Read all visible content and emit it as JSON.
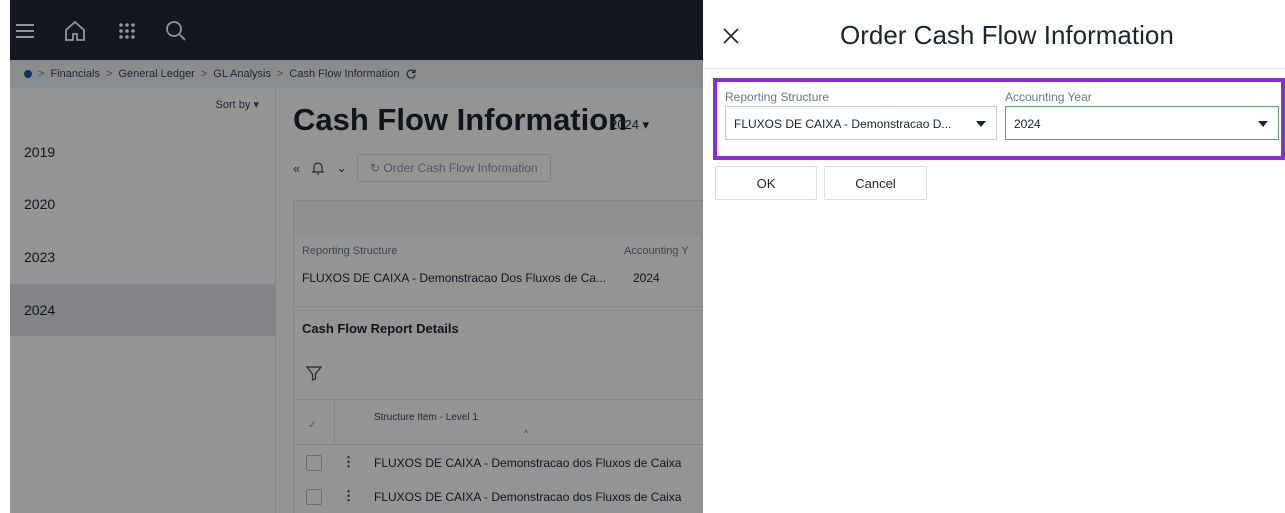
{
  "breadcrumb": {
    "items": [
      "Financials",
      "General Ledger",
      "GL Analysis",
      "Cash Flow Information"
    ]
  },
  "sidebar": {
    "sort_label": "Sort by",
    "years": [
      "2019",
      "2020",
      "2023",
      "2024"
    ],
    "selected": "2024"
  },
  "page": {
    "title": "Cash Flow Information",
    "title_year": "2024",
    "order_button": "Order Cash Flow Information"
  },
  "header_card": {
    "reporting_structure_label": "Reporting Structure",
    "reporting_structure_value": "FLUXOS DE CAIXA - Demonstracao Dos Fluxos de Ca...",
    "accounting_year_label": "Accounting Y",
    "accounting_year_value": "2024"
  },
  "details": {
    "title": "Cash Flow Report Details",
    "column_header": "Structure Item - Level 1",
    "rows": [
      "FLUXOS DE CAIXA - Demonstracao dos Fluxos de Caixa",
      "FLUXOS DE CAIXA - Demonstracao dos Fluxos de Caixa"
    ]
  },
  "dialog": {
    "title": "Order Cash Flow Information",
    "reporting_structure_label": "Reporting Structure",
    "reporting_structure_value": "FLUXOS DE CAIXA - Demonstracao D...",
    "accounting_year_label": "Accounting Year",
    "accounting_year_value": "2024",
    "ok_label": "OK",
    "cancel_label": "Cancel"
  },
  "colors": {
    "topbar": "#222a36",
    "focus_outline": "#8a2be2",
    "field_focus": "#5aa86f"
  },
  "icons": [
    "menu-icon",
    "home-icon",
    "apps-grid-icon",
    "search-icon",
    "refresh-icon",
    "collapse-icon",
    "bell-icon",
    "filter-icon",
    "close-icon",
    "dropdown-caret-icon"
  ]
}
